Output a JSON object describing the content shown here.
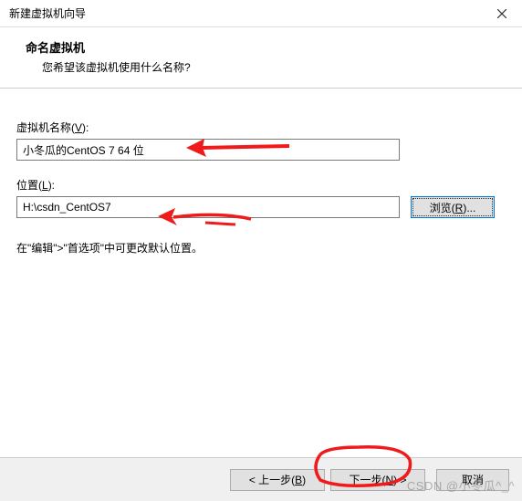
{
  "window": {
    "title": "新建虚拟机向导"
  },
  "header": {
    "title": "命名虚拟机",
    "subtitle": "您希望该虚拟机使用什么名称?"
  },
  "form": {
    "name_label_pre": "虚拟机名称(",
    "name_label_key": "V",
    "name_label_post": "):",
    "name_value": "小冬瓜的CentOS 7 64 位",
    "loc_label_pre": "位置(",
    "loc_label_key": "L",
    "loc_label_post": "):",
    "loc_value": "H:\\csdn_CentOS7",
    "browse_pre": "浏览(",
    "browse_key": "R",
    "browse_post": ")...",
    "note": "在\"编辑\">\"首选项\"中可更改默认位置。"
  },
  "buttons": {
    "back_pre": "< 上一步(",
    "back_key": "B",
    "back_post": ")",
    "next_pre": "下一步(",
    "next_key": "N",
    "next_post": ") >",
    "cancel": "取消"
  },
  "watermark": "CSDN @小冬瓜^_^"
}
